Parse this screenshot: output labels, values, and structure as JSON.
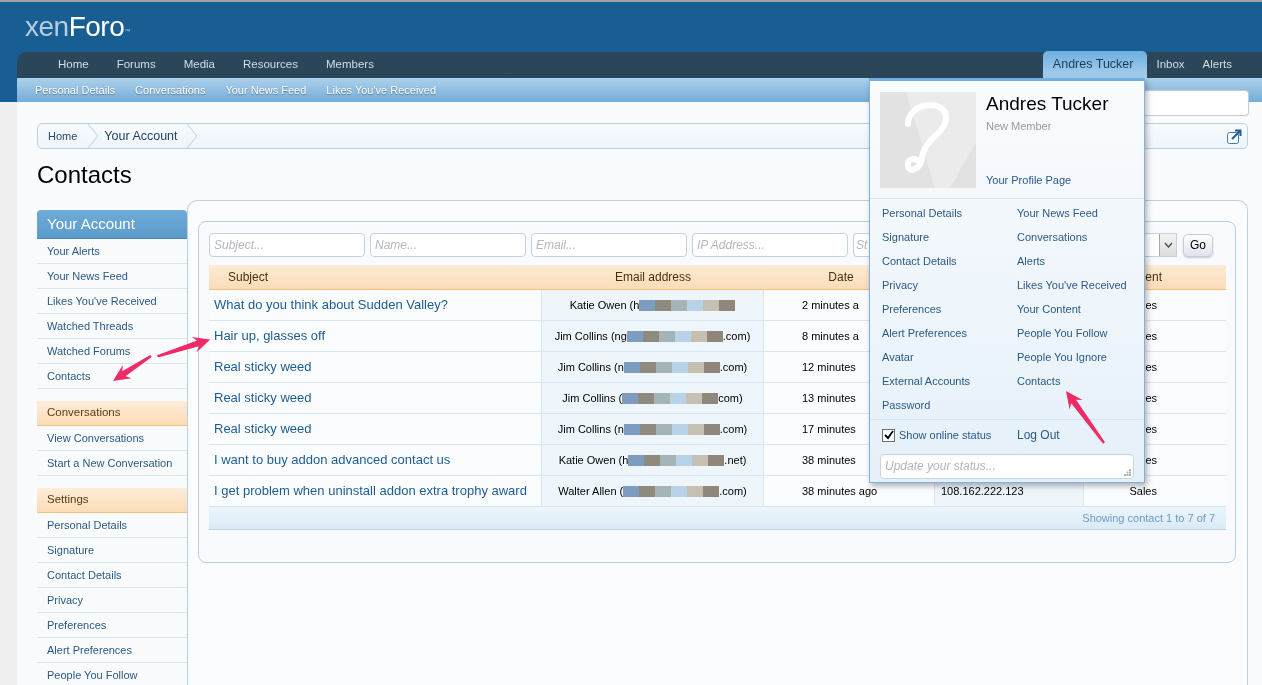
{
  "header": {
    "logo": {
      "prefix": "xen",
      "name": "Foro",
      "mark": "™"
    }
  },
  "nav": {
    "left": [
      {
        "label": "Home",
        "selected": false
      },
      {
        "label": "Forums",
        "selected": false
      },
      {
        "label": "Media",
        "selected": false
      },
      {
        "label": "Resources",
        "selected": false
      },
      {
        "label": "Members",
        "selected": false
      }
    ],
    "right": [
      {
        "label": "Andres Tucker",
        "selected": true
      },
      {
        "label": "Inbox",
        "selected": false
      },
      {
        "label": "Alerts",
        "selected": false
      }
    ]
  },
  "subnav": [
    "Personal Details",
    "Conversations",
    "Your News Feed",
    "Likes You've Received"
  ],
  "breadcrumb": [
    "Home",
    "Your Account"
  ],
  "page_title": "Contacts",
  "sidebar": [
    {
      "title": "Your Account",
      "kind": "primary",
      "items": [
        "Your Alerts",
        "Your News Feed",
        "Likes You've Received",
        "Watched Threads",
        "Watched Forums",
        "Contacts"
      ]
    },
    {
      "title": "Conversations",
      "kind": "secondary",
      "items": [
        "View Conversations",
        "Start a New Conversation"
      ]
    },
    {
      "title": "Settings",
      "kind": "secondary",
      "items": [
        "Personal Details",
        "Signature",
        "Contact Details",
        "Privacy",
        "Preferences",
        "Alert Preferences",
        "People You Follow"
      ]
    }
  ],
  "filters": {
    "fields": [
      {
        "placeholder": "Subject..."
      },
      {
        "placeholder": "Name..."
      },
      {
        "placeholder": "Email..."
      },
      {
        "placeholder": "IP Address..."
      },
      {
        "placeholder": "St"
      }
    ],
    "go_button": "Go"
  },
  "table": {
    "columns": {
      "subject": "Subject",
      "email": "Email address",
      "date": "Date",
      "column_5": "ent"
    },
    "rows": [
      {
        "subject": "What do you think about Sudden Valley?",
        "email_start": "Katie Owen (h",
        "date": "2 minutes a",
        "column_5": "es"
      },
      {
        "subject": "Hair up, glasses off",
        "email_start": "Jim Collins (ng",
        "email_end": ".com)",
        "date": "8 minutes a",
        "column_5": "es"
      },
      {
        "subject": "Real sticky weed",
        "email_start": "Jim Collins (n",
        "email_end": ".com)",
        "date": "12 minutes",
        "column_5": "es"
      },
      {
        "subject": "Real sticky weed",
        "email_start": "Jim Collins (",
        "email_end": "com)",
        "date": "13 minutes",
        "column_5": "es"
      },
      {
        "subject": "Real sticky weed",
        "email_start": "Jim Collins (n",
        "email_end": ".com)",
        "date": "17 minutes",
        "column_5": "es"
      },
      {
        "subject": "I want to buy addon advanced contact us",
        "email_start": "Katie Owen (h",
        "email_end": ".net)",
        "date": "38 minutes",
        "column_5": "es"
      },
      {
        "subject": "I get problem when uninstall addon extra trophy award",
        "email_start": "Walter Allen (",
        "email_end": ".com)",
        "date": "38 minutes ago",
        "column_4": "108.162.222.123",
        "column_5": "Sales"
      }
    ],
    "footer": "Showing contact 1 to 7 of 7"
  },
  "account_menu": {
    "name": "Andres Tucker",
    "title": "New Member",
    "profile_link": "Your Profile Page",
    "left_links": [
      "Personal Details",
      "Signature",
      "Contact Details",
      "Privacy",
      "Preferences",
      "Alert Preferences",
      "Avatar",
      "External Accounts",
      "Password"
    ],
    "right_links": [
      "Your News Feed",
      "Conversations",
      "Alerts",
      "Likes You've Received",
      "Your Content",
      "People You Follow",
      "People You Ignore",
      "Contacts"
    ],
    "show_online": {
      "label": "Show online status",
      "checked": true
    },
    "logout": "Log Out",
    "status": {
      "placeholder": "Update your status..."
    }
  }
}
